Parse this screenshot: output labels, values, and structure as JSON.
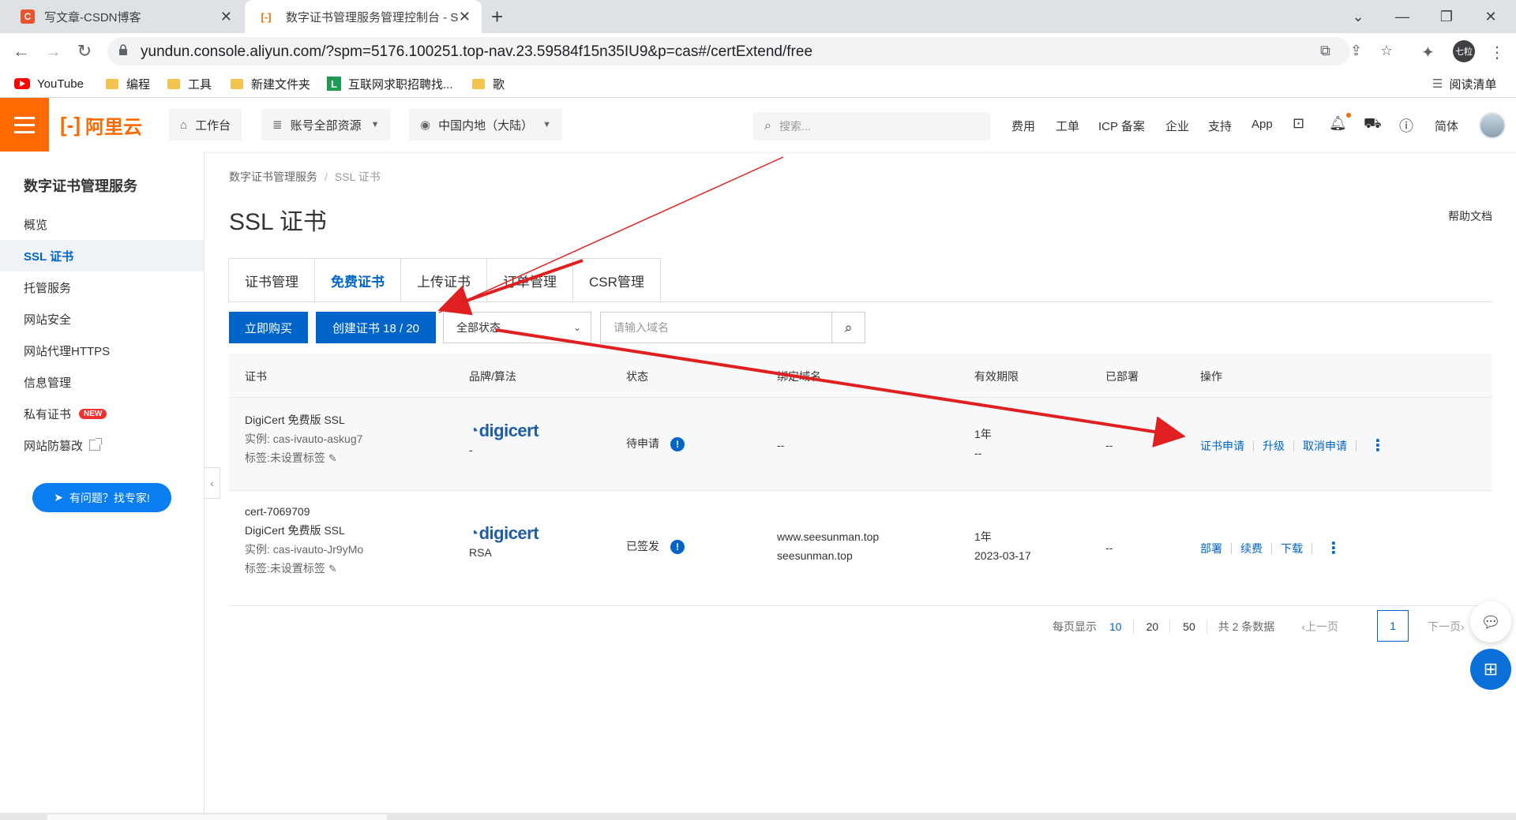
{
  "browser": {
    "tabs": [
      {
        "title": "写文章-CSDN博客",
        "favicon": "C"
      },
      {
        "title": "数字证书管理服务管理控制台 - S",
        "favicon": "[-]"
      }
    ],
    "new_tab": "+",
    "url": "yundun.console.aliyun.com/?spm=5176.100251.top-nav.23.59584f15n35IU9&p=cas#/certExtend/free",
    "profile_initials": "七粒",
    "bookmarks": [
      {
        "label": "YouTube",
        "type": "youtube"
      },
      {
        "label": "编程",
        "type": "folder"
      },
      {
        "label": "工具",
        "type": "folder"
      },
      {
        "label": "新建文件夹",
        "type": "folder"
      },
      {
        "label": "互联网求职招聘找...",
        "type": "site"
      },
      {
        "label": "歌",
        "type": "folder"
      }
    ],
    "reading_list": "阅读清单"
  },
  "topnav": {
    "logo": "阿里云",
    "workbench": "工作台",
    "account_resources": "账号全部资源",
    "region": "中国内地（大陆）",
    "search_placeholder": "搜索...",
    "links": [
      "费用",
      "工单",
      "ICP 备案",
      "企业",
      "支持",
      "App"
    ],
    "lang": "简体",
    "accent": "#ff6a00"
  },
  "sidebar": {
    "title": "数字证书管理服务",
    "items": [
      {
        "label": "概览"
      },
      {
        "label": "SSL 证书",
        "active": true
      },
      {
        "label": "托管服务"
      },
      {
        "label": "网站安全"
      },
      {
        "label": "网站代理HTTPS"
      },
      {
        "label": "信息管理"
      },
      {
        "label": "私有证书",
        "badge": "NEW"
      },
      {
        "label": "网站防篡改",
        "external": true
      }
    ],
    "expert_button": "有问题？找专家!"
  },
  "main": {
    "breadcrumb": [
      "数字证书管理服务",
      "SSL 证书"
    ],
    "title": "SSL 证书",
    "help_doc": "帮助文档",
    "tabs": [
      "证书管理",
      "免费证书",
      "上传证书",
      "订单管理",
      "CSR管理"
    ],
    "active_tab": 1,
    "buy_button": "立即购买",
    "create_button": "创建证书 18 / 20",
    "status_select": "全部状态",
    "domain_placeholder": "请输入域名",
    "columns": [
      "证书",
      "品牌/算法",
      "状态",
      "绑定域名",
      "有效期限",
      "已部署",
      "操作"
    ],
    "rows": [
      {
        "name": "",
        "product": "DigiCert 免费版 SSL",
        "instance": "实例: cas-ivauto-askug7",
        "tag": "标签:未设置标签",
        "brand": "digicert",
        "algo": "-",
        "status": "待申请",
        "domains": [
          "--"
        ],
        "validity": "1年",
        "expiry": "--",
        "deployed": "--",
        "actions": [
          "证书申请",
          "升级",
          "取消申请"
        ]
      },
      {
        "name": "cert-7069709",
        "product": "DigiCert 免费版 SSL",
        "instance": "实例: cas-ivauto-Jr9yMo",
        "tag": "标签:未设置标签",
        "brand": "digicert",
        "algo": "RSA",
        "status": "已签发",
        "domains": [
          "www.seesunman.top",
          "seesunman.top"
        ],
        "validity": "1年",
        "expiry": "2023-03-17",
        "deployed": "--",
        "actions": [
          "部署",
          "续费",
          "下载"
        ]
      }
    ],
    "pager": {
      "per_page_label": "每页显示",
      "sizes": [
        "10",
        "20",
        "50"
      ],
      "current_size": "10",
      "total": "共 2 条数据",
      "prev": "上一页",
      "page": "1",
      "next": "下一页"
    }
  },
  "annotation_color": "#e02020"
}
